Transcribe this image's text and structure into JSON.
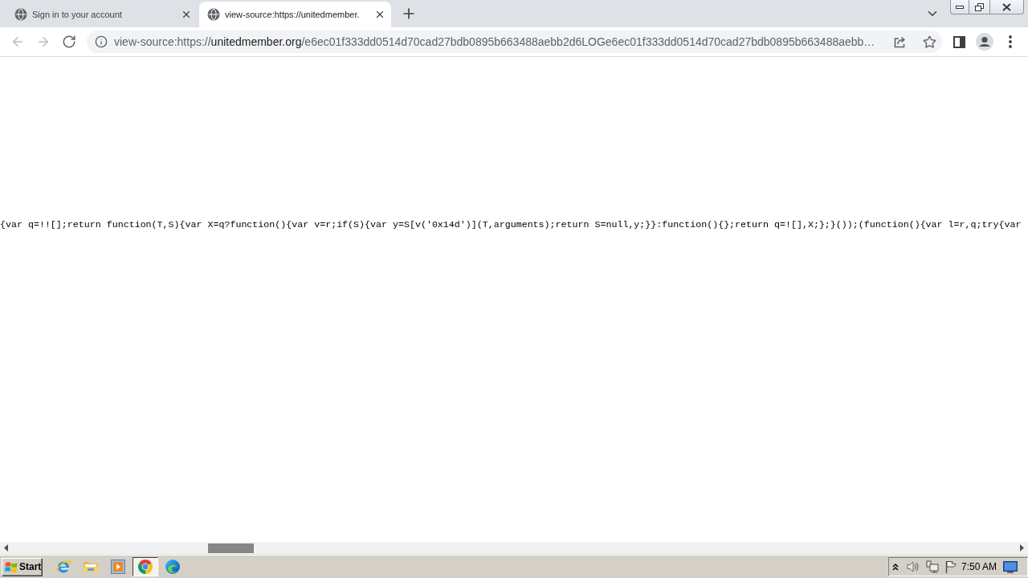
{
  "tabs": [
    {
      "title": "Sign in to your account",
      "selected": false
    },
    {
      "title": "view-source:https://unitedmember.",
      "selected": true
    }
  ],
  "toolbar": {
    "nav_buttons": [
      {
        "kind": "back",
        "disabled": true
      },
      {
        "kind": "forward",
        "disabled": true
      },
      {
        "kind": "reload",
        "disabled": false
      }
    ],
    "address": {
      "scheme": "view-source:https://",
      "host": "unitedmember.org",
      "path": "/e6ec01f333dd0514d70cad27bdb0895b663488aebb2d6LOGe6ec01f333dd0514d70cad27bdb0895b663488aebb…"
    }
  },
  "source": {
    "lines": [
      "{var q=!![];return function(T,S){var X=q?function(){var v=r;if(S){var y=S[v('0x14d')](T,arguments);return S=null,y;}}:function(){};return q=![],X;};}());(function(){var l=r,q;try{var"
    ]
  },
  "taskbar": {
    "start_label": "Start",
    "apps": [
      {
        "kind": "ie",
        "selected": false
      },
      {
        "kind": "explorer",
        "selected": false
      },
      {
        "kind": "media",
        "selected": false
      },
      {
        "kind": "chrome",
        "selected": true
      },
      {
        "kind": "edge",
        "selected": false
      }
    ],
    "clock": "7:50 AM"
  }
}
